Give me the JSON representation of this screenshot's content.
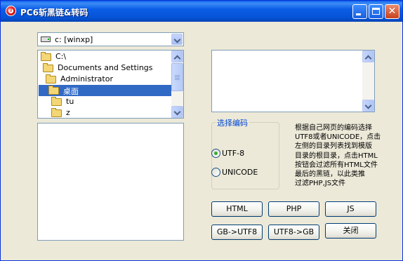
{
  "window": {
    "title": "PC6斩黑链&转码",
    "controls": {
      "minimize": "minimize-icon",
      "maximize": "maximize-icon",
      "close": "✕"
    }
  },
  "drive": {
    "value": "c: [winxp]"
  },
  "folders": {
    "items": [
      {
        "label": "C:\\"
      },
      {
        "label": "Documents and Settings"
      },
      {
        "label": "Administrator"
      },
      {
        "label": "桌面",
        "selected": true
      },
      {
        "label": "tu"
      },
      {
        "label": "z"
      }
    ]
  },
  "encoding": {
    "group_title": "选择编码",
    "options": [
      {
        "label": "UTF-8",
        "checked": true
      },
      {
        "label": "UNICODE",
        "checked": false
      }
    ]
  },
  "help_lines": [
    "根据自己网页的编码选择",
    "UTF8或者UNICODE，点击",
    "左侧的目录列表找到模版",
    "目录的根目录，点击HTML",
    "按钮会过滤所有HTML文件",
    "最后的黑链，以此类推",
    "过滤PHP,JS文件"
  ],
  "buttons": {
    "html": "HTML",
    "php": "PHP",
    "js": "JS",
    "gb_utf8": "GB->UTF8",
    "utf8_gb": "UTF8->GB",
    "close": "关闭"
  },
  "colors": {
    "titlebar": "#0653d6",
    "selection": "#316ac5",
    "group_title": "#0046d5",
    "radio_dot": "#3bab2f"
  }
}
